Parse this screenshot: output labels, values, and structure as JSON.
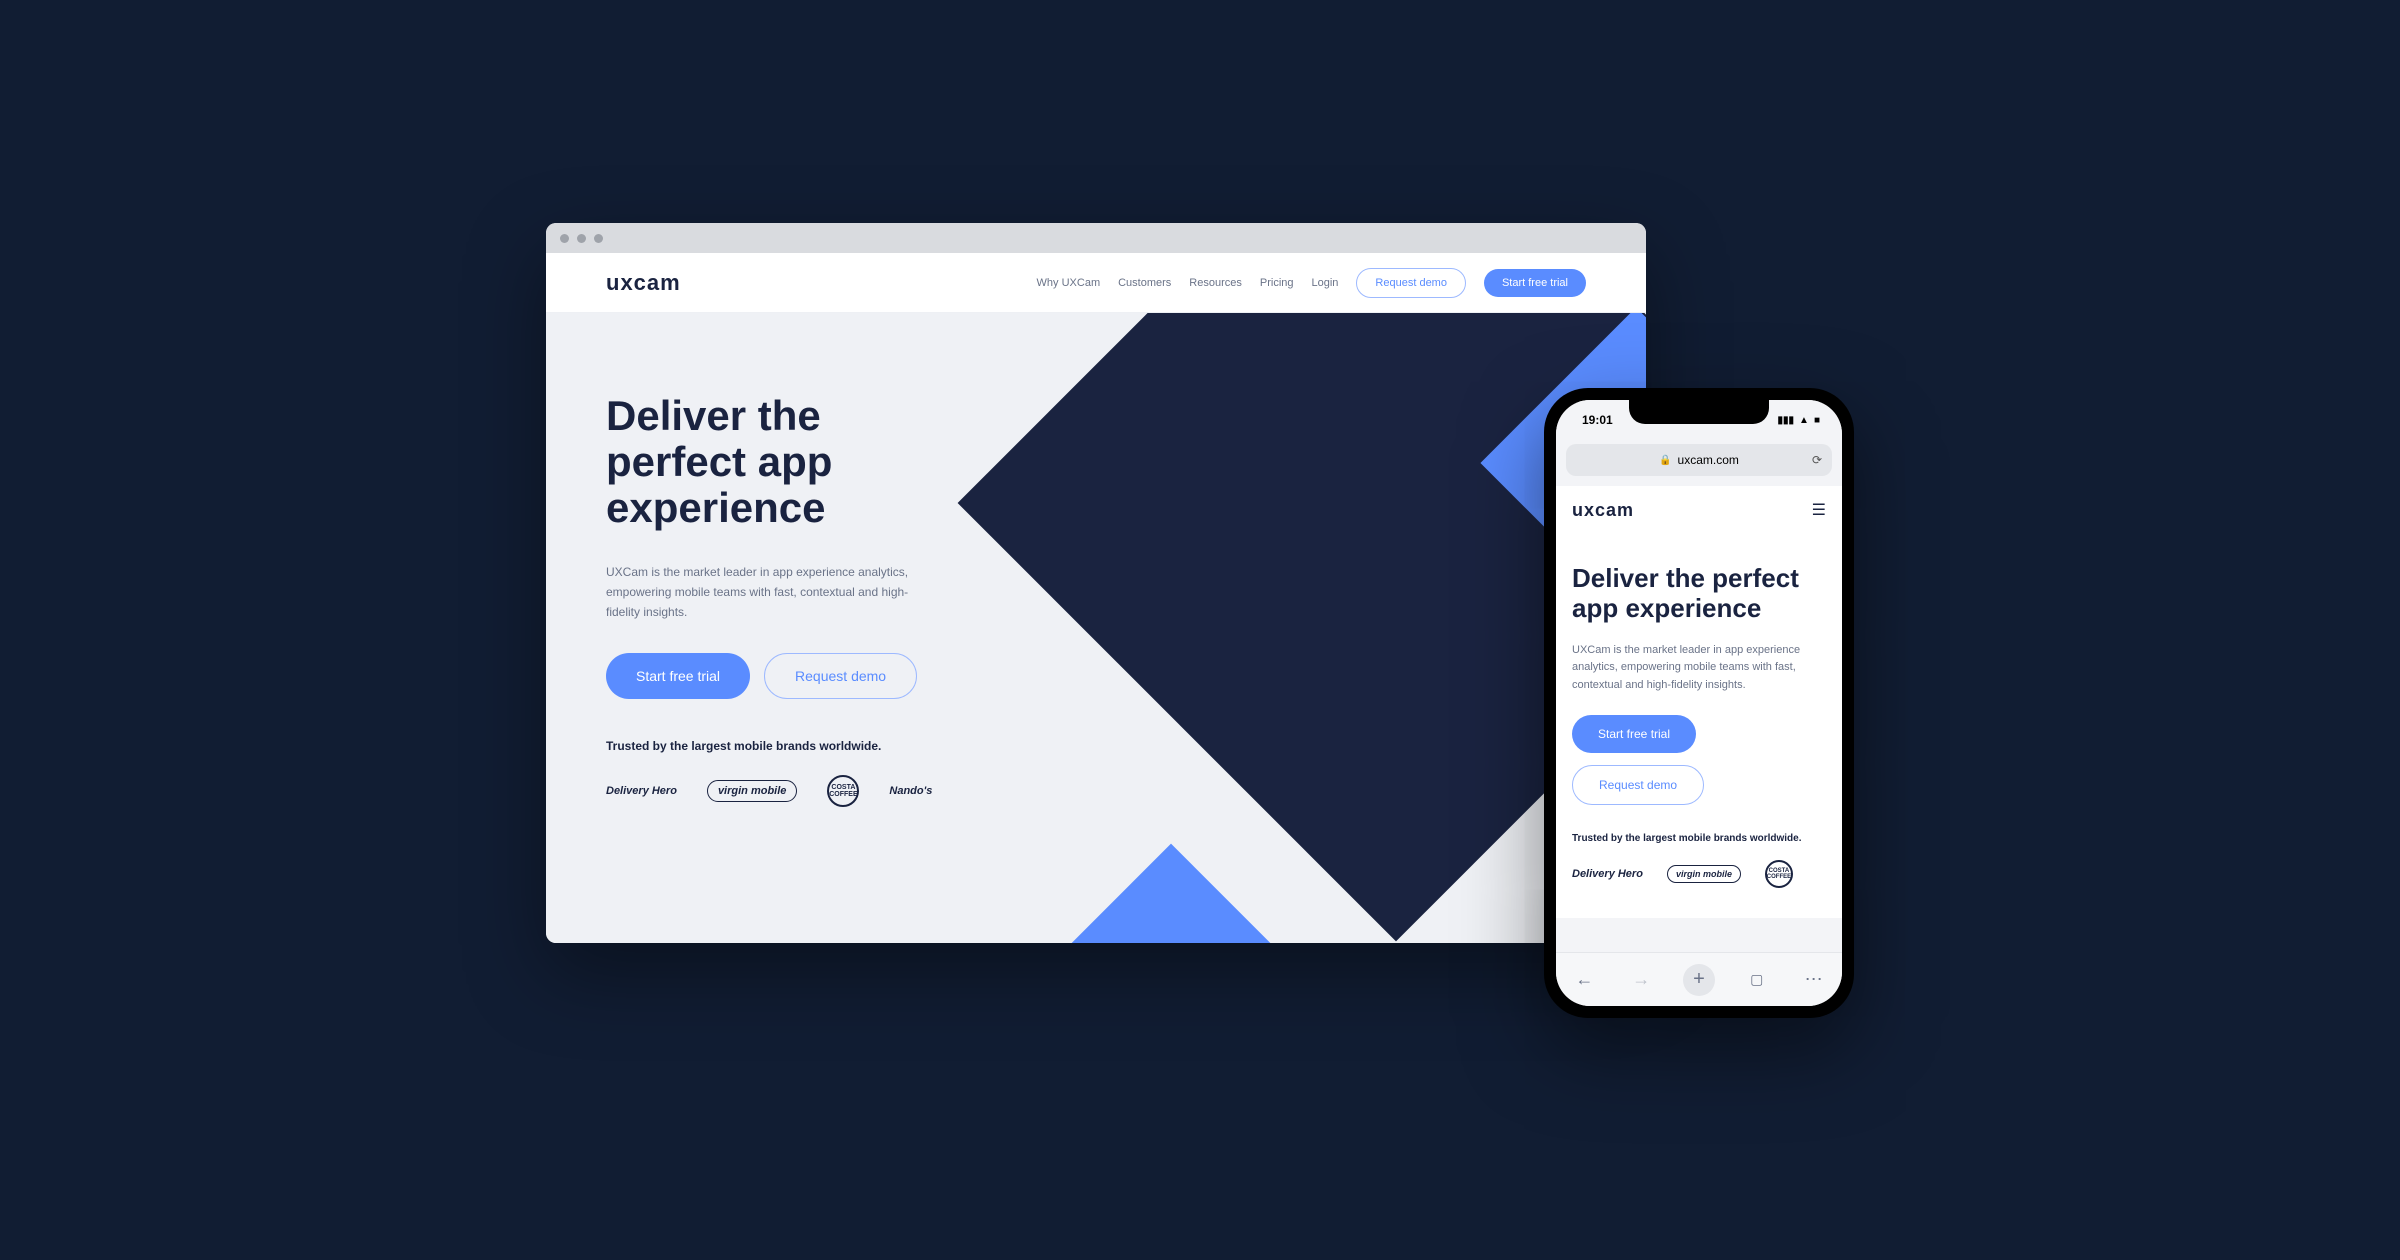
{
  "desktop": {
    "logo": "uxcam",
    "nav": {
      "items": [
        "Why UXCam",
        "Customers",
        "Resources",
        "Pricing",
        "Login"
      ],
      "request_demo": "Request demo",
      "start_trial": "Start free trial"
    },
    "hero": {
      "headline": "Deliver the perfect app experience",
      "subtext": "UXCam is the market leader in app experience analytics, empowering mobile teams with fast, contextual and high-fidelity insights.",
      "cta_primary": "Start free trial",
      "cta_secondary": "Request demo",
      "trusted": "Trusted by the largest mobile brands worldwide.",
      "brands": [
        "Delivery Hero",
        "virgin mobile",
        "COSTA COFFEE",
        "Nando's"
      ]
    }
  },
  "mobile": {
    "status_time": "19:01",
    "url": "uxcam.com",
    "logo": "uxcam",
    "hero": {
      "headline": "Deliver the perfect app experience",
      "subtext": "UXCam is the market leader in app experience analytics, empowering mobile teams with fast, contextual and high-fidelity insights.",
      "cta_primary": "Start free trial",
      "cta_secondary": "Request demo",
      "trusted": "Trusted by the largest mobile brands worldwide.",
      "brands": [
        "Delivery Hero",
        "virgin mobile",
        "COSTA COFFEE"
      ]
    }
  }
}
